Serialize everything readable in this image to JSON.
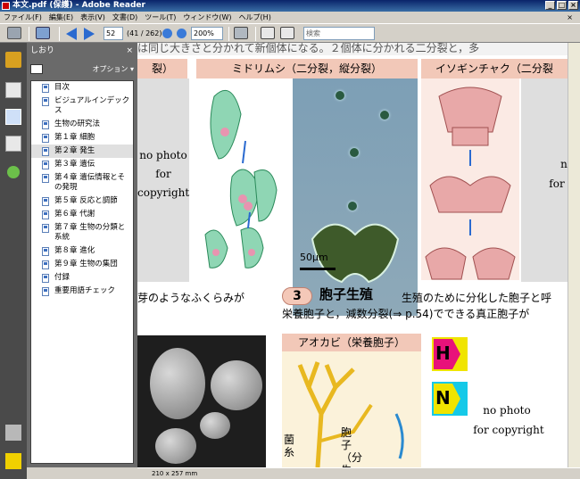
{
  "window": {
    "title": "本文.pdf (保護) - Adobe Reader"
  },
  "menu": [
    "ファイル(F)",
    "編集(E)",
    "表示(V)",
    "文書(D)",
    "ツール(T)",
    "ウィンドウ(W)",
    "ヘルプ(H)"
  ],
  "toolbar": {
    "page_value": "52",
    "page_info": "(41 / 262)",
    "zoom_value": "200%",
    "search_placeholder": "検索"
  },
  "bookmarks": {
    "header": "しおり",
    "options": "オプション",
    "items": [
      {
        "label": "目次"
      },
      {
        "label": "ビジュアルインデックス"
      },
      {
        "label": "生物の研究法"
      },
      {
        "label": "第１章 細胞"
      },
      {
        "label": "第２章 発生"
      },
      {
        "label": "第３章 遺伝"
      },
      {
        "label": "第４章 遺伝情報とその発現"
      },
      {
        "label": "第５章 反応と調節"
      },
      {
        "label": "第６章 代謝"
      },
      {
        "label": "第７章 生物の分類と系統"
      },
      {
        "label": "第８章 進化"
      },
      {
        "label": "第９章 生物の集団"
      },
      {
        "label": "付録"
      },
      {
        "label": "重要用語チェック"
      }
    ],
    "selected_index": 4
  },
  "status": {
    "page_size": "210 x 257 mm"
  },
  "document": {
    "top_line": "は同じ大きさと分かれて新個体になる。２個体に分かれる二分裂と，多",
    "head_left": "裂）",
    "head_mid": "ミドリムシ（二分裂，縦分裂）",
    "head_right": "イソギンチャク（二分裂",
    "nophoto_left": "no photo",
    "for_left": "for",
    "copyright_left": "copyright",
    "n_right": "n",
    "for_right": "for",
    "scale_label": "50μm",
    "body_left": "芽のようなふくらみが",
    "badge": "3",
    "section_title": "胞子生殖",
    "section_desc": "生殖のために分化した胞子と呼",
    "line2": "栄養胞子と，減数分裂(⇒ p.54)でできる真正胞子が",
    "head_bottom": "アオカビ（栄養胞子）",
    "label_kinshi": "菌糸",
    "label_houshi": "胞子（分生胞",
    "h_letter": "H",
    "n_letter": "N",
    "nophoto_bottom": "no photo",
    "copyright_bottom": "for copyright",
    "colors": {
      "section_bg": "#f2c8b8",
      "badge_bg": "#f4c8b8"
    }
  }
}
